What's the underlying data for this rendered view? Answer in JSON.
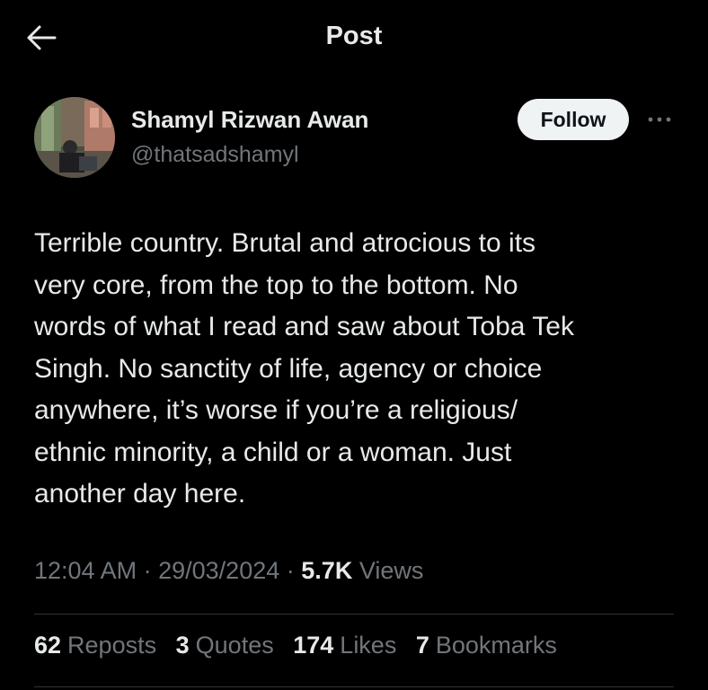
{
  "header": {
    "title": "Post",
    "back_icon": "arrow-left-icon"
  },
  "author": {
    "display_name": "Shamyl Rizwan Awan",
    "handle": "@thatsadshamyl",
    "follow_label": "Follow",
    "more_icon": "more-horizontal-icon"
  },
  "post": {
    "text_lines": [
      "Terrible country. Brutal and atrocious to its",
      "very core, from the top to the bottom. No",
      "words of what I read and saw about Toba Tek",
      "Singh. No sanctity of life, agency or choice",
      "anywhere, it’s worse if you’re a religious/",
      "ethnic minority, a child or a woman. Just",
      "another day here."
    ]
  },
  "meta": {
    "time": "12:04 AM",
    "separator": "·",
    "date": "29/03/2024",
    "views_count": "5.7K",
    "views_label": "Views"
  },
  "stats": {
    "reposts_count": "62",
    "reposts_label": "Reposts",
    "quotes_count": "3",
    "quotes_label": "Quotes",
    "likes_count": "174",
    "likes_label": "Likes",
    "bookmarks_count": "7",
    "bookmarks_label": "Bookmarks"
  },
  "colors": {
    "background": "#000000",
    "primary_text": "#e7e9ea",
    "secondary_text": "#71767b",
    "divider": "#2f3336",
    "follow_button_bg": "#eff3f4"
  }
}
